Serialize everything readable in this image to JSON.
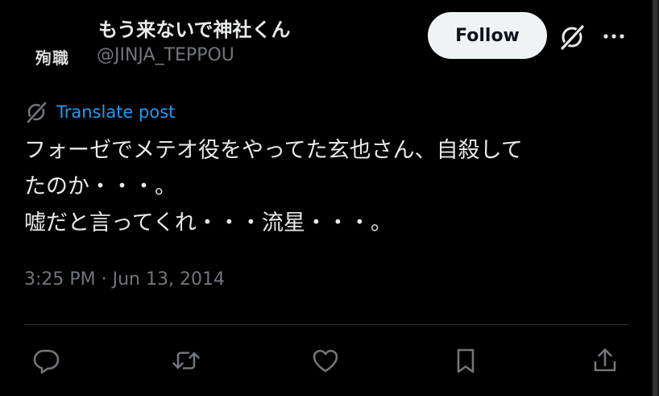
{
  "author": {
    "display_name": "もう来ないで神社くん",
    "handle": "@JINJA_TEPPOU",
    "avatar_text": "殉職"
  },
  "header": {
    "follow_label": "Follow",
    "icons": [
      "grok-icon",
      "more-icon"
    ]
  },
  "translate": {
    "label": "Translate post",
    "icon": "grok-icon"
  },
  "post": {
    "lines": [
      "フォーゼでメテオ役をやってた玄也さん、自殺して",
      "たのか・・・。",
      "嘘だと言ってくれ・・・流星・・・。"
    ]
  },
  "meta": {
    "timestamp": "3:25 PM · Jun 13, 2014"
  },
  "actions": [
    "reply-icon",
    "repost-icon",
    "like-icon",
    "bookmark-icon",
    "share-icon"
  ],
  "colors": {
    "background": "#000000",
    "text": "#e7e9ea",
    "muted": "#71767b",
    "accent": "#1d9bf0",
    "follow_bg": "#eff3f4"
  }
}
